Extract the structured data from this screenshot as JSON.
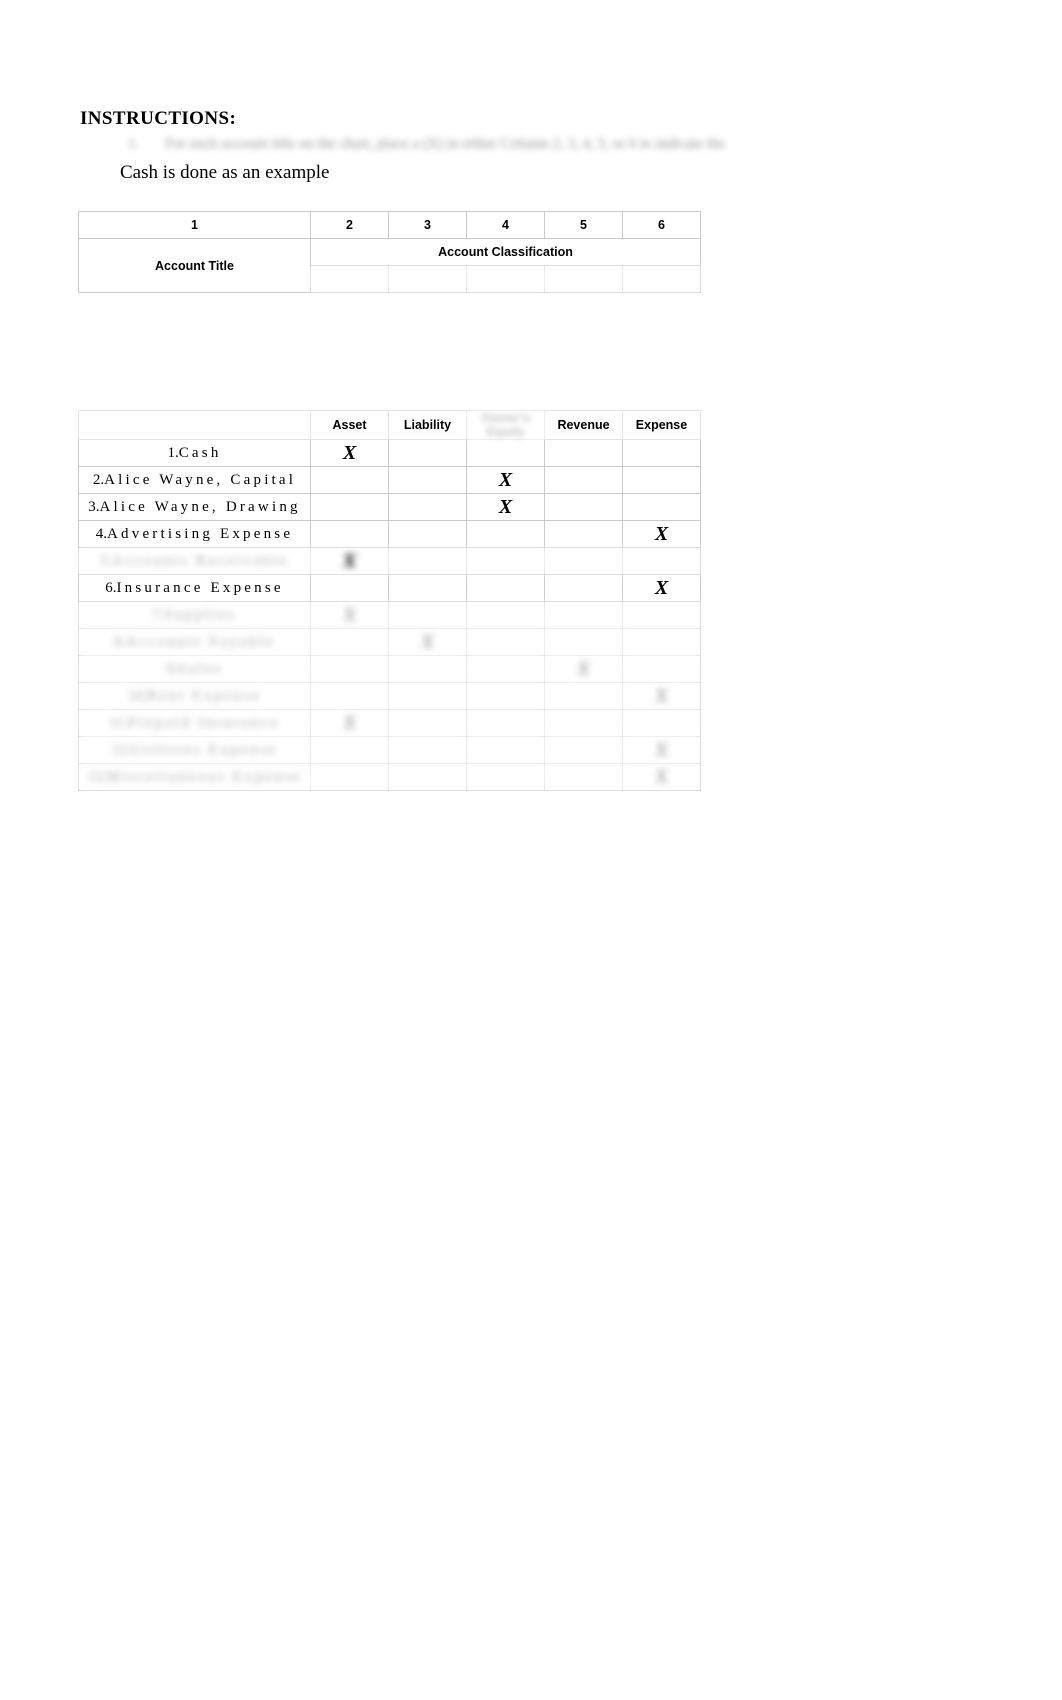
{
  "document": {
    "instructions_heading": "INSTRUCTIONS:",
    "instruction_number": "1.",
    "instruction_text": "For each account title on the chart, place a (X) in either Column 2, 3, 4, 5, or 6 to indicate the",
    "instruction_subline": "Cash is done as an example"
  },
  "table_top": {
    "column_numbers": [
      "1",
      "2",
      "3",
      "4",
      "5",
      "6"
    ],
    "group_header": "Account Classification",
    "account_title_header": "Account Title"
  },
  "table_main": {
    "column_headers": [
      "",
      "Asset",
      "Liability",
      "",
      "Revenue",
      "Expense"
    ],
    "owners_equity_header": "Owner's Equity",
    "mark_symbol": "X",
    "rows": [
      {
        "index": "1",
        "title": "Cash",
        "mark_col": 1,
        "blurred": false
      },
      {
        "index": "2",
        "title": "Alice Wayne, Capital",
        "mark_col": 3,
        "blurred": false
      },
      {
        "index": "3",
        "title": "Alice Wayne, Drawing",
        "mark_col": 3,
        "blurred": false
      },
      {
        "index": "4",
        "title": "Advertising Expense",
        "mark_col": 5,
        "blurred": false
      },
      {
        "index": "5",
        "title": "Accounts Receivable",
        "mark_col": 1,
        "blurred": true
      },
      {
        "index": "6",
        "title": "Insurance Expense",
        "mark_col": 5,
        "blurred": false
      },
      {
        "index": "7",
        "title": "Supplies",
        "mark_col": 1,
        "blurred": true
      },
      {
        "index": "8",
        "title": "Accounts Payable",
        "mark_col": 2,
        "blurred": true
      },
      {
        "index": "9",
        "title": "Sales",
        "mark_col": 4,
        "blurred": true
      },
      {
        "index": "10",
        "title": "Rent Expense",
        "mark_col": 5,
        "blurred": true
      },
      {
        "index": "11",
        "title": "Prepaid Insurance",
        "mark_col": 1,
        "blurred": true
      },
      {
        "index": "12",
        "title": "Utilities Expense",
        "mark_col": 5,
        "blurred": true
      },
      {
        "index": "13",
        "title": "Miscellaneous Expense",
        "mark_col": 5,
        "blurred": true
      }
    ]
  },
  "colors": {
    "grid_line": "#c9c9c9",
    "shade": "#f2f2f2",
    "text": "#000000",
    "redacted": "#b4b4b4"
  }
}
